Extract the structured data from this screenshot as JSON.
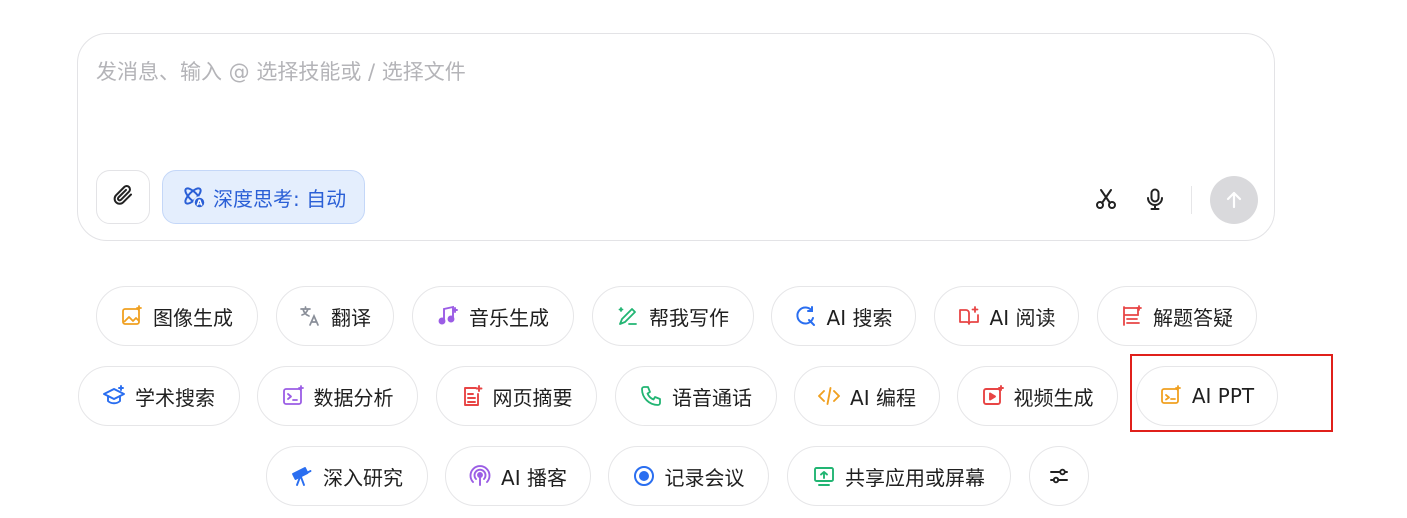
{
  "composer": {
    "placeholder": "发消息、输入 @ 选择技能或 / 选择文件",
    "value": "",
    "deep_think_label": "深度思考: 自动",
    "colors": {
      "accent": "#2a5fd6",
      "accent_bg": "#e4eefd",
      "send_disabled": "#d9d9dc"
    }
  },
  "skills": {
    "row1": [
      {
        "label": "图像生成",
        "icon": "image-sparkle-icon",
        "color": "#f0a020"
      },
      {
        "label": "翻译",
        "icon": "translate-icon",
        "color": "#8a8f99"
      },
      {
        "label": "音乐生成",
        "icon": "music-note-icon",
        "color": "#9b5de5"
      },
      {
        "label": "帮我写作",
        "icon": "pen-sparkle-icon",
        "color": "#22b573"
      },
      {
        "label": "AI 搜索",
        "icon": "search-refresh-icon",
        "color": "#2a6ef0"
      },
      {
        "label": "AI 阅读",
        "icon": "book-sparkle-icon",
        "color": "#e84545"
      },
      {
        "label": "解题答疑",
        "icon": "question-board-icon",
        "color": "#e84545"
      }
    ],
    "row2": [
      {
        "label": "学术搜索",
        "icon": "graduation-cap-icon",
        "color": "#2a6ef0"
      },
      {
        "label": "数据分析",
        "icon": "data-terminal-icon",
        "color": "#9b5de5"
      },
      {
        "label": "网页摘要",
        "icon": "web-doc-sparkle-icon",
        "color": "#e84545"
      },
      {
        "label": "语音通话",
        "icon": "phone-icon",
        "color": "#22b573"
      },
      {
        "label": "AI 编程",
        "icon": "code-icon",
        "color": "#f0a020"
      },
      {
        "label": "视频生成",
        "icon": "video-play-icon",
        "color": "#e84545"
      },
      {
        "label": "AI PPT",
        "icon": "ppt-sparkle-icon",
        "color": "#f0a020"
      }
    ],
    "row3": [
      {
        "label": "深入研究",
        "icon": "telescope-icon",
        "color": "#2a6ef0"
      },
      {
        "label": "AI 播客",
        "icon": "podcast-icon",
        "color": "#9b5de5"
      },
      {
        "label": "记录会议",
        "icon": "record-dot-icon",
        "color": "#2a6ef0"
      },
      {
        "label": "共享应用或屏幕",
        "icon": "screen-share-icon",
        "color": "#22b573"
      }
    ]
  }
}
